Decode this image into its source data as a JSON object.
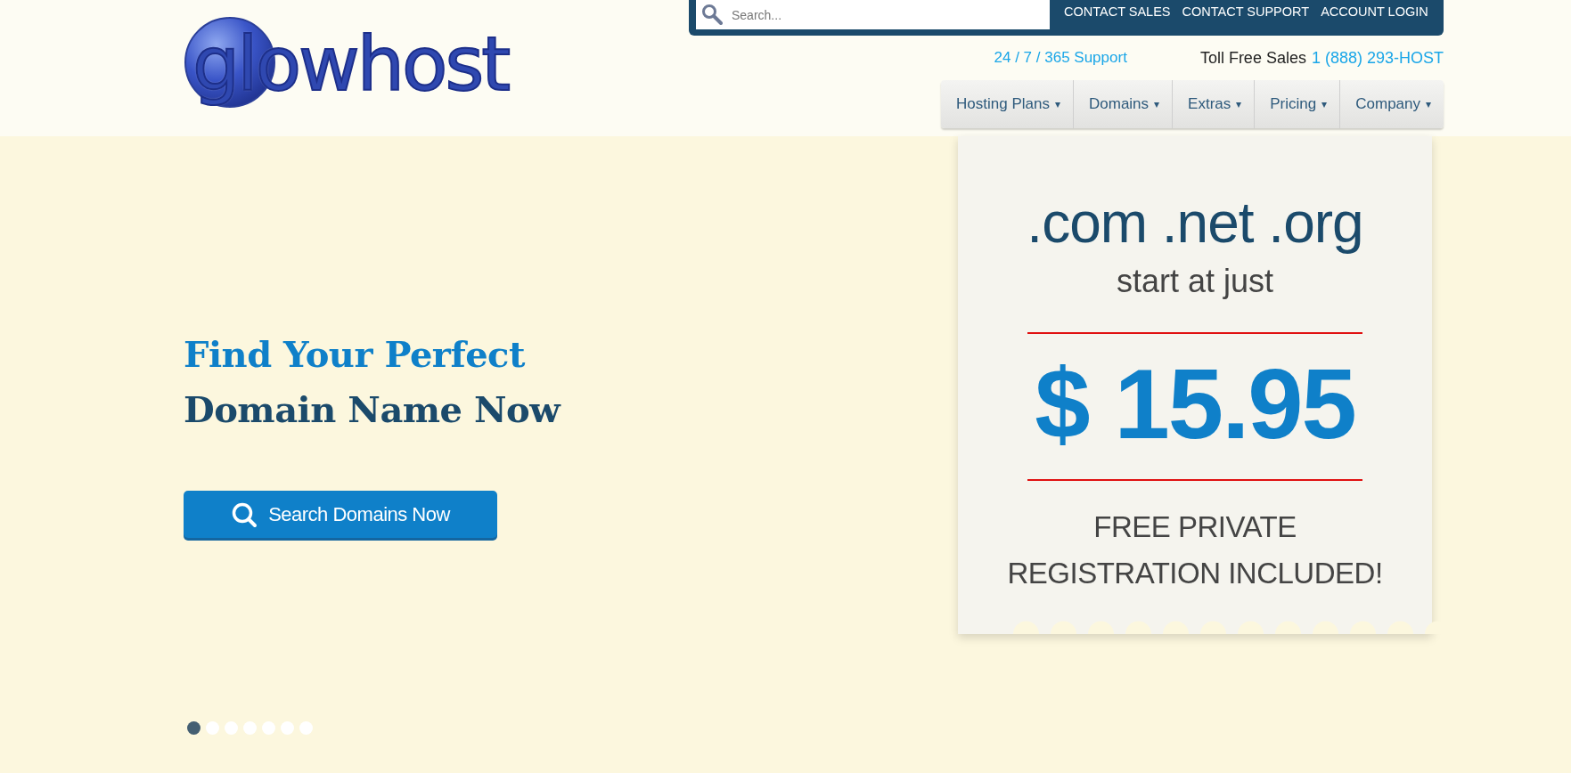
{
  "logo": {
    "text": "glowhost"
  },
  "top_bar": {
    "search": {
      "placeholder": "Search..."
    },
    "links": [
      "CONTACT SALES",
      "CONTACT SUPPORT",
      "ACCOUNT LOGIN"
    ]
  },
  "support_line": {
    "support": "24 / 7 / 365 Support",
    "sales_label": "Toll Free Sales",
    "sales_phone": "1 (888) 293-HOST"
  },
  "nav": [
    {
      "label": "Hosting Plans",
      "caret": "▾"
    },
    {
      "label": "Domains",
      "caret": "▾"
    },
    {
      "label": "Extras",
      "caret": "▾"
    },
    {
      "label": "Pricing",
      "caret": "▾"
    },
    {
      "label": "Company",
      "caret": "▾"
    }
  ],
  "hero": {
    "heading_line_1": "Find Your Perfect",
    "heading_line_2": "Domain Name Now",
    "button": "Search Domains Now"
  },
  "ticket": {
    "tlds": ".com .net .org",
    "subtitle": "start at just",
    "price": "$ 15.95",
    "note_line_1": "FREE PRIVATE",
    "note_line_2": "REGISTRATION INCLUDED!"
  },
  "carousel_dots": [
    {
      "selected": true
    },
    {
      "selected": false
    },
    {
      "selected": false
    },
    {
      "selected": false
    },
    {
      "selected": false
    },
    {
      "selected": false
    },
    {
      "selected": false
    }
  ]
}
